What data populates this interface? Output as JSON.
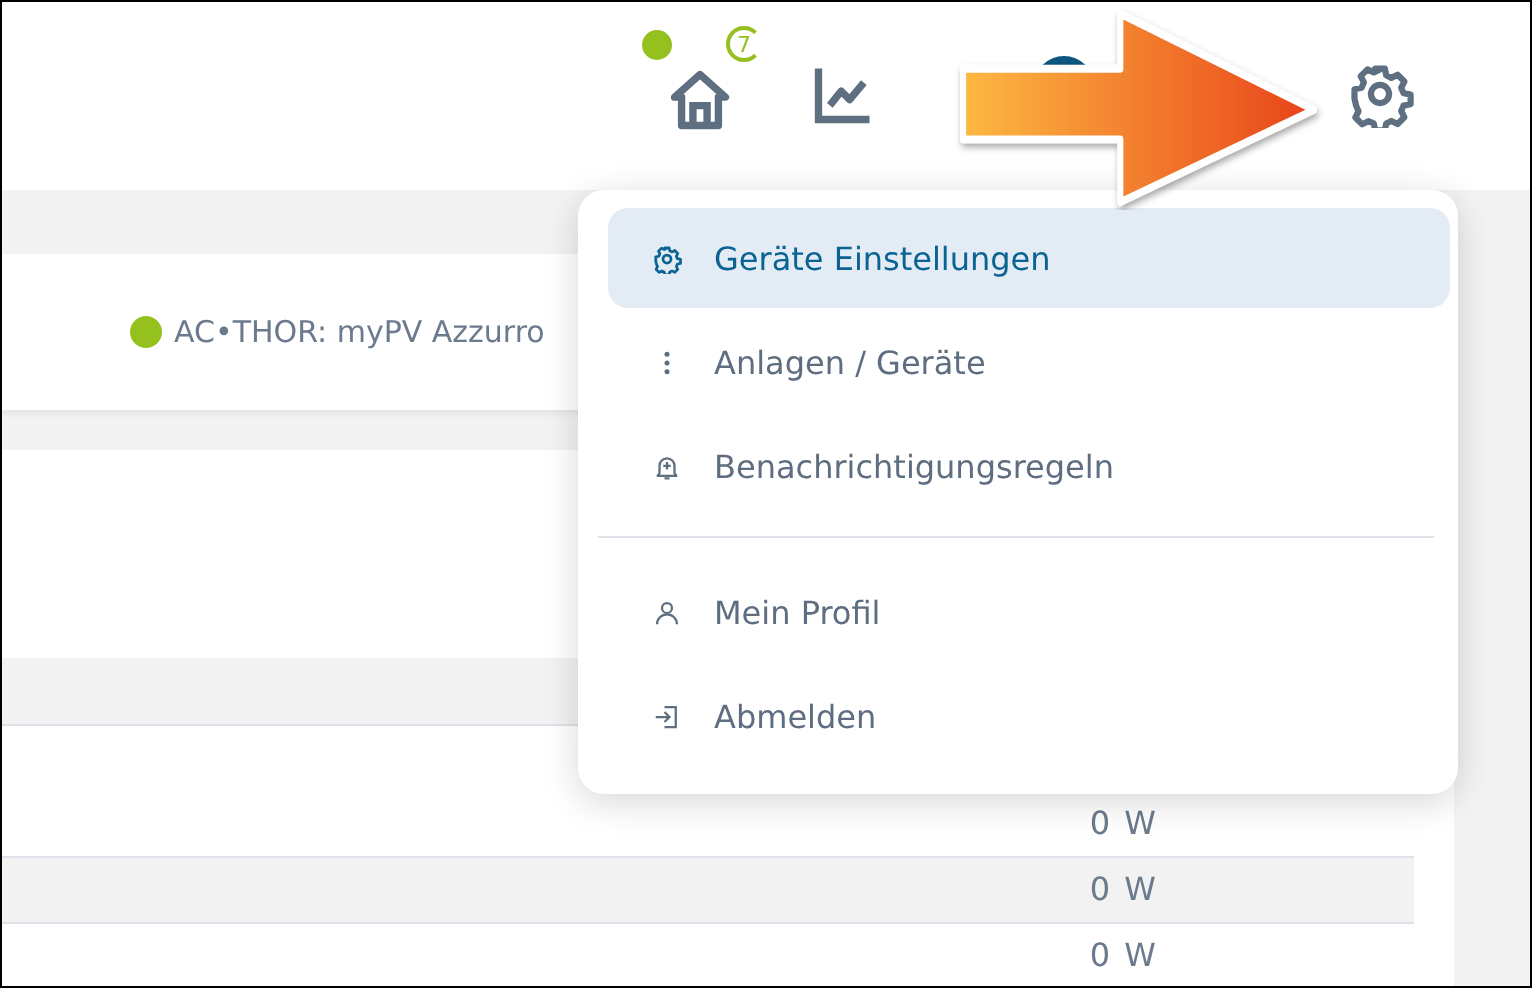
{
  "header": {
    "timer_badge": "7"
  },
  "device_card": {
    "label": "AC•THOR: myPV Azzurro"
  },
  "rows": [
    {
      "value": "0 W"
    },
    {
      "value": "0 W"
    },
    {
      "value": "0 W"
    }
  ],
  "settings_menu": {
    "groups": [
      [
        {
          "label": "Geräte Einstellungen",
          "selected": true
        },
        {
          "label": "Anlagen / Geräte",
          "selected": false
        },
        {
          "label": "Benachrichtigungsregeln",
          "selected": false
        }
      ],
      [
        {
          "label": "Mein Profil",
          "selected": false
        },
        {
          "label": "Abmelden",
          "selected": false
        }
      ]
    ]
  }
}
